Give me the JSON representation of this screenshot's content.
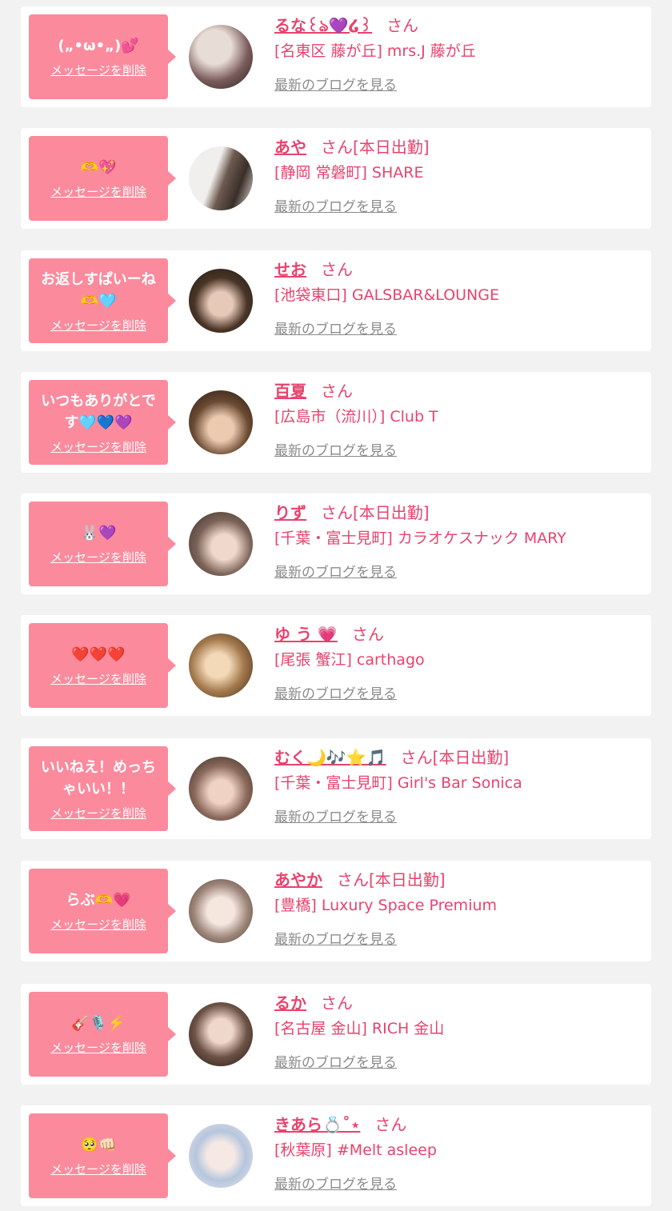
{
  "blog_link_label": "最新のブログを見る",
  "delete_label": "メッセージを削除",
  "san_label": "さん",
  "colors": {
    "bubble": "#fb8a9d",
    "accent": "#e8436d",
    "link_gray": "#8b8b8b",
    "background": "#f2f2f2"
  },
  "messages": [
    {
      "bubble": "(„•ω•„)💕",
      "name": "るな꒰ঌ💜໒꒱",
      "work": "",
      "shop": "[名東区 藤が丘] mrs.J 藤が丘"
    },
    {
      "bubble": "🫶💖",
      "name": "あや",
      "work": "[本日出勤]",
      "shop": "[静岡 常磐町] SHARE"
    },
    {
      "bubble": "お返しすぱいーね🫶🩵",
      "name": "せお",
      "work": "",
      "shop": "[池袋東口] GALSBAR&LOUNGE"
    },
    {
      "bubble": "いつもありがとです🩵💙💜",
      "name": "百夏",
      "work": "",
      "shop": "[広島市（流川）] Club T"
    },
    {
      "bubble": "🐰💜",
      "name": "りず",
      "work": "[本日出勤]",
      "shop": "[千葉・富士見町] カラオケスナック MARY"
    },
    {
      "bubble": "❤️❤️❤️",
      "name": "ゆ う 💗",
      "work": "",
      "shop": "[尾張 蟹江] carthago"
    },
    {
      "bubble": "いいねえ！めっちゃいい！！",
      "name": "むく🌙🎶⭐️🎵",
      "work": "[本日出勤]",
      "shop": "[千葉・富士見町] Girl's Bar Sonica"
    },
    {
      "bubble": "らぶ🫶💗",
      "name": "あやか",
      "work": "[本日出勤]",
      "shop": "[豊橋] Luxury Space Premium"
    },
    {
      "bubble": "🎸🎙️⚡️",
      "name": "るか",
      "work": "",
      "shop": "[名古屋 金山] RICH 金山"
    },
    {
      "bubble": "🥺👊🏻",
      "name": "きあら💍˚⋆",
      "work": "",
      "shop": "[秋葉原] #Melt asleep"
    }
  ]
}
